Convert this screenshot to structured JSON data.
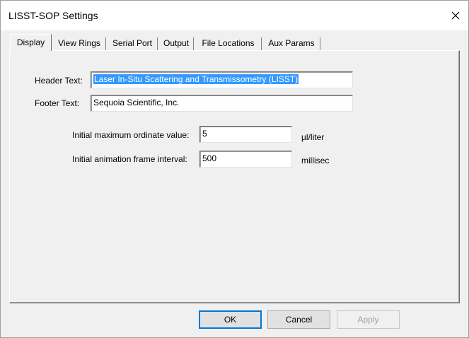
{
  "window": {
    "title": "LISST-SOP Settings",
    "close_icon": "close-icon"
  },
  "tabs": [
    {
      "label": "Display",
      "active": true
    },
    {
      "label": "View Rings",
      "active": false
    },
    {
      "label": "Serial Port",
      "active": false
    },
    {
      "label": "Output",
      "active": false
    },
    {
      "label": "File Locations",
      "active": false
    },
    {
      "label": "Aux Params",
      "active": false
    }
  ],
  "display": {
    "header_label": "Header Text:",
    "header_value": "Laser In-Situ Scattering and Transmissometry (LISST)",
    "footer_label": "Footer Text:",
    "footer_value": "Sequoia Scientific, Inc.",
    "max_ordinate_label": "Initial maximum ordinate value:",
    "max_ordinate_value": "5",
    "max_ordinate_unit": "µl/liter",
    "frame_interval_label": "Initial animation frame interval:",
    "frame_interval_value": "500",
    "frame_interval_unit": "millisec"
  },
  "buttons": {
    "ok": "OK",
    "cancel": "Cancel",
    "apply": "Apply"
  },
  "colors": {
    "selection": "#3399ff",
    "default_button_border": "#0078d7"
  }
}
